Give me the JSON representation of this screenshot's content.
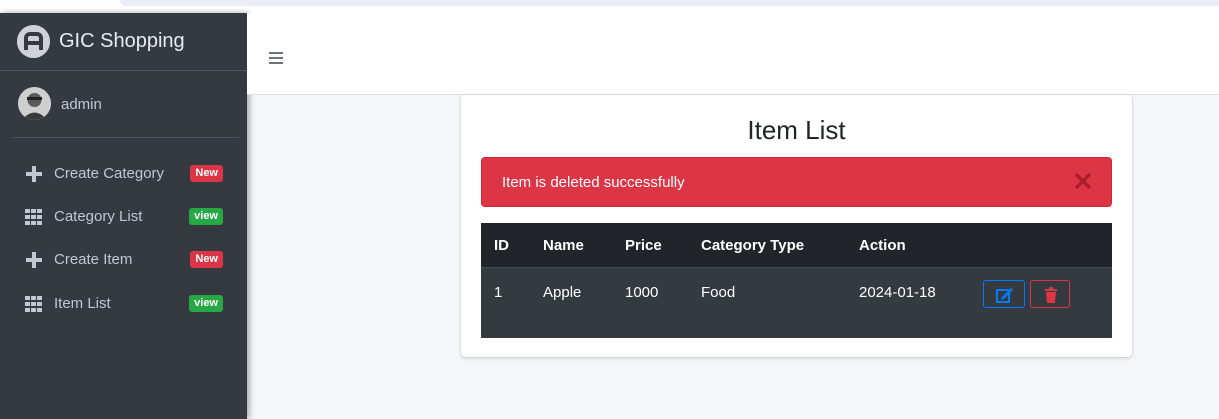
{
  "brand": {
    "name": "GIC Shopping"
  },
  "user": {
    "name": "admin"
  },
  "sidebar": {
    "items": [
      {
        "label": "Create Category",
        "badge": "New",
        "icon": "plus-icon"
      },
      {
        "label": "Category List",
        "badge": "view",
        "icon": "grid-icon"
      },
      {
        "label": "Create Item",
        "badge": "New",
        "icon": "plus-icon"
      },
      {
        "label": "Item List",
        "badge": "view",
        "icon": "grid-icon"
      }
    ]
  },
  "page": {
    "title": "Item List"
  },
  "alert": {
    "message": "Item is deleted successfully",
    "icon": "close-icon"
  },
  "table": {
    "headers": [
      "ID",
      "Name",
      "Price",
      "Category Type",
      "Action"
    ],
    "rows": [
      {
        "id": "1",
        "name": "Apple",
        "price": "1000",
        "category_type": "Food",
        "action": "2024-01-18"
      }
    ]
  },
  "colors": {
    "sidebar_bg": "#343a40",
    "danger": "#dc3545",
    "success": "#28a745",
    "primary": "#007bff"
  }
}
